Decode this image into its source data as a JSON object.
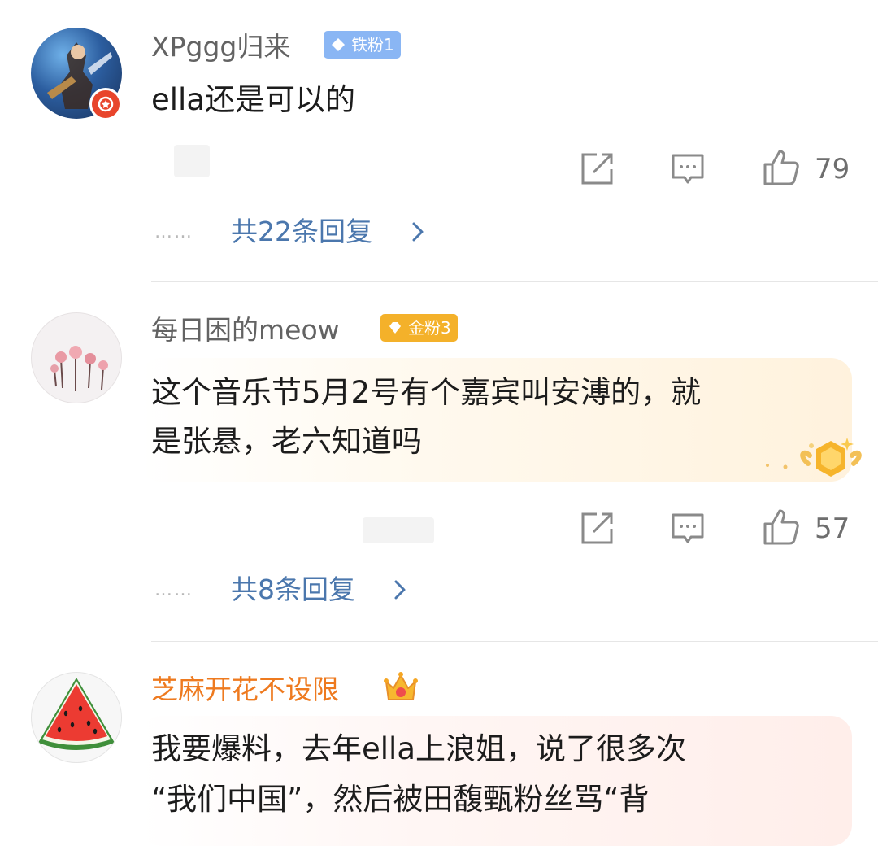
{
  "comments": [
    {
      "username": "XPggg归来",
      "badge": {
        "label": "铁粉1",
        "color": "#8ab6f4"
      },
      "text_lines": [
        "ella还是可以的"
      ],
      "likes": "79",
      "replies": "共22条回复",
      "avatar_icon": "game-character-avatar"
    },
    {
      "username": "每日困的meow",
      "badge": {
        "label": "金粉3",
        "color": "#f4b12a"
      },
      "text_lines": [
        "这个音乐节5月2号有个嘉宾叫安溥的，就",
        "是张悬，老六知道吗"
      ],
      "likes": "57",
      "replies": "共8条回复",
      "avatar_icon": "flower-avatar"
    },
    {
      "username": "芝麻开花不设限",
      "username_color": "#ee7a1f",
      "crown_icon": "crown-icon",
      "text_lines": [
        "我要爆料，去年ella上浪姐，说了很多次",
        "“我们中国”，然后被田馥甄粉丝骂“背"
      ],
      "avatar_icon": "watermelon-avatar"
    }
  ],
  "ui": {
    "dots": "……",
    "share_icon": "share-icon",
    "comment_icon": "comment-icon",
    "like_icon": "thumbs-up-icon",
    "chevron_icon": "chevron-right-icon"
  }
}
